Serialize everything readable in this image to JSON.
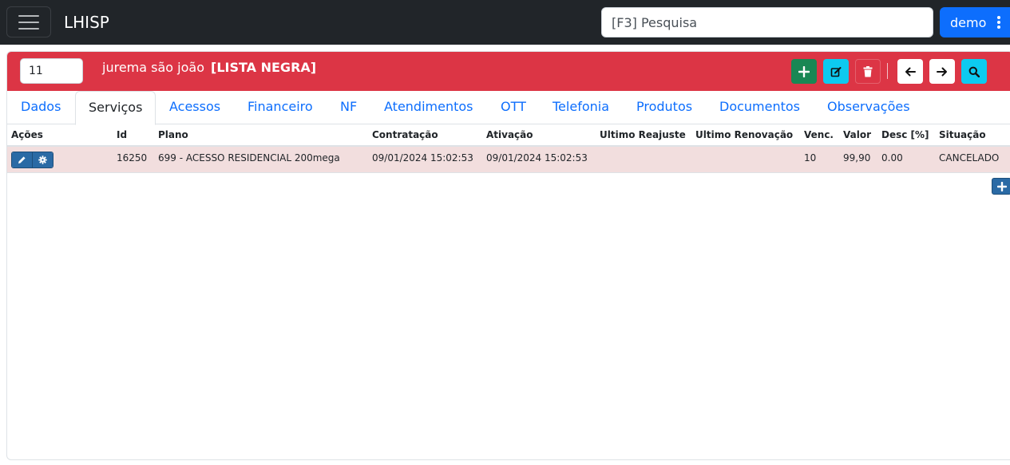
{
  "app": {
    "title": "LHISP"
  },
  "search": {
    "placeholder": "[F3] Pesquisa"
  },
  "user": {
    "name": "demo"
  },
  "client": {
    "id": "11",
    "name": "jurema são joão",
    "flag": "[LISTA NEGRA]"
  },
  "header_actions": [
    "plus-icon",
    "edit-icon",
    "trash-icon",
    "arrow-left-icon",
    "arrow-right-icon",
    "search-icon"
  ],
  "tabs": [
    {
      "label": "Dados"
    },
    {
      "label": "Serviços"
    },
    {
      "label": "Acessos"
    },
    {
      "label": "Financeiro"
    },
    {
      "label": "NF"
    },
    {
      "label": "Atendimentos"
    },
    {
      "label": "OTT"
    },
    {
      "label": "Telefonia"
    },
    {
      "label": "Produtos"
    },
    {
      "label": "Documentos"
    },
    {
      "label": "Observações"
    }
  ],
  "active_tab": "Serviços",
  "table": {
    "columns": [
      "Ações",
      "Id",
      "Plano",
      "Contratação",
      "Ativação",
      "Ultimo Reajuste",
      "Ultimo Renovação",
      "Venc.",
      "Valor",
      "Desc [%]",
      "Situação"
    ],
    "rows": [
      {
        "id": "16250",
        "plano": "699 - ACESSO RESIDENCIAL 200mega",
        "contratacao": "09/01/2024 15:02:53",
        "ativacao": "09/01/2024 15:02:53",
        "ultimo_reajuste": "",
        "ultimo_renovacao": "",
        "venc": "10",
        "valor": "99,90",
        "desc": "0.00",
        "situacao": "CANCELADO"
      }
    ]
  },
  "colors": {
    "navbar": "#212529",
    "header_danger": "#dc3545",
    "primary": "#0d6efd",
    "success": "#198754",
    "info": "#0dcaf0",
    "row_danger": "#f2dede"
  }
}
